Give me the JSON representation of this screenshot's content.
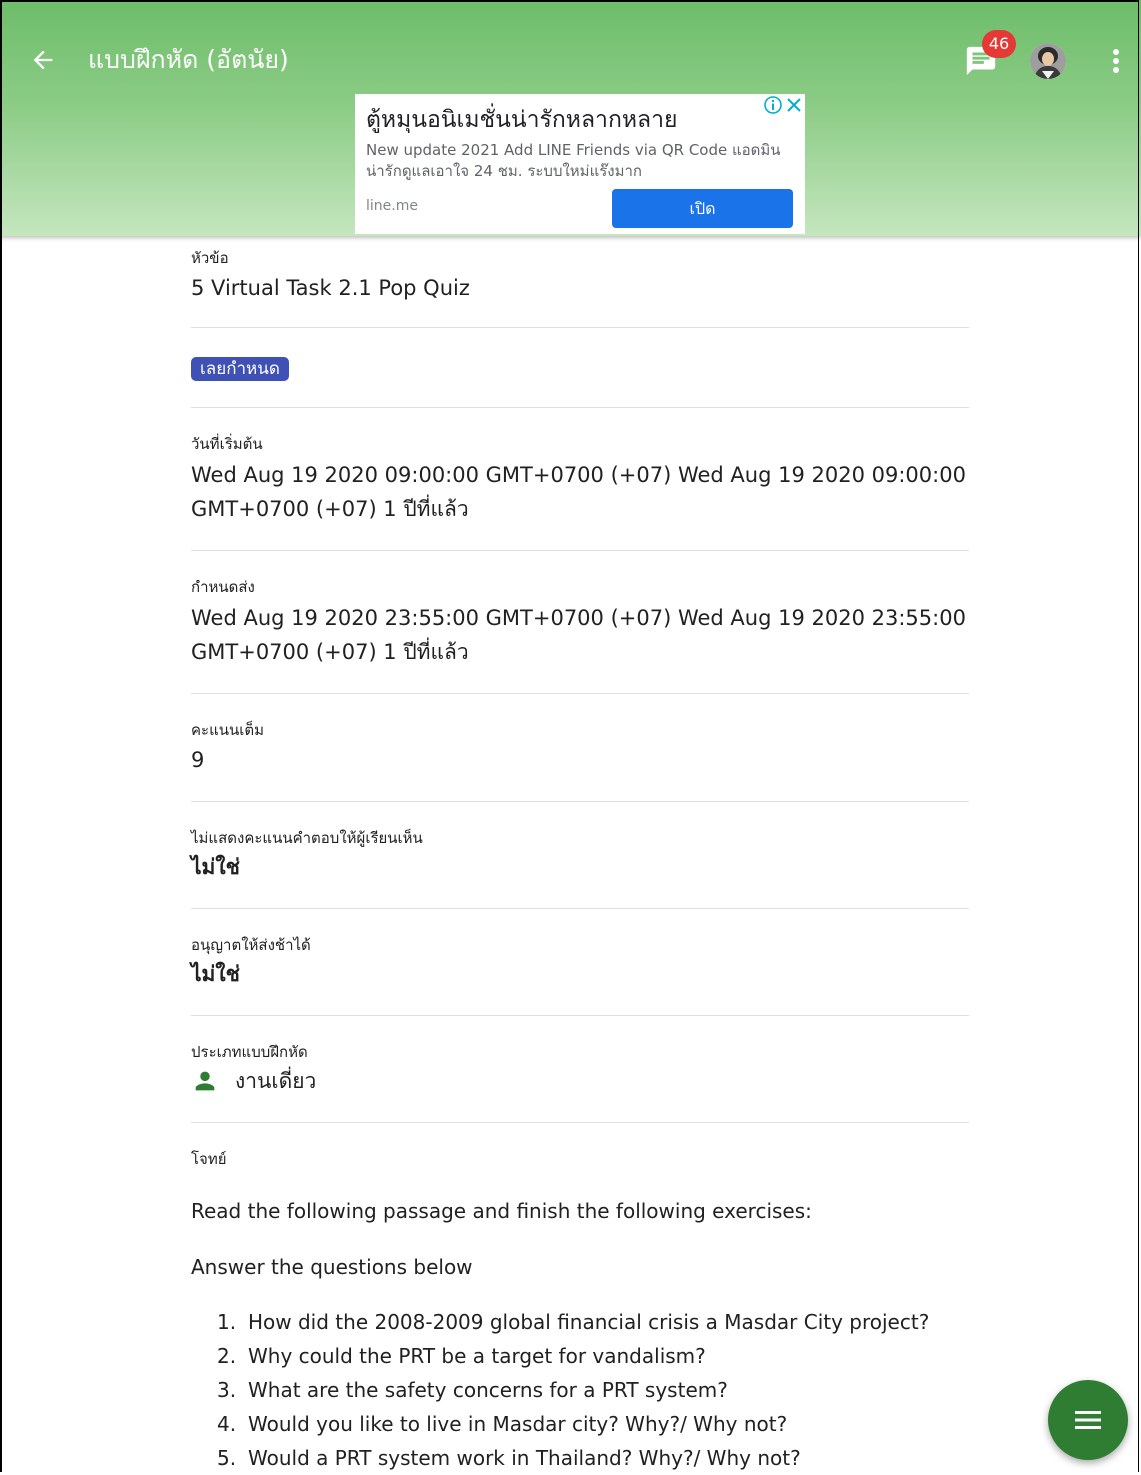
{
  "appbar": {
    "title": "แบบฝึกหัด (อัตนัย)",
    "back_icon": "arrow-left-icon",
    "chat_icon": "chat-icon",
    "chat_badge": "46",
    "more_icon": "more-vert-icon",
    "color": "#6dbd6a"
  },
  "ad": {
    "title": "ตู้หมุนอนิเมชั่นน่ารักหลากหลาย",
    "description": "New update 2021 Add LINE Friends via QR Code แอดมินน่ารักดูแลเอาใจ 24 ชม. ระบบใหม่แร๊งมาก",
    "domain": "line.me",
    "open_label": "เปิด",
    "accent": "#1a73e8"
  },
  "details": {
    "topic_label": "หัวข้อ",
    "topic_value": "5 Virtual Task 2.1 Pop Quiz",
    "status_chip": "เลยกำหนด",
    "start_label": "วันที่เริ่มต้น",
    "start_value": "Wed Aug 19 2020 09:00:00 GMT+0700 (+07) Wed Aug 19 2020 09:00:00 GMT+0700 (+07) 1 ปีที่แล้ว",
    "due_label": "กำหนดส่ง",
    "due_value": "Wed Aug 19 2020 23:55:00 GMT+0700 (+07) Wed Aug 19 2020 23:55:00 GMT+0700 (+07) 1 ปีที่แล้ว",
    "score_label": "คะแนนเต็ม",
    "score_value": "9",
    "hide_score_label": "ไม่แสดงคะแนนคำตอบให้ผู้เรียนเห็น",
    "hide_score_value": "ไม่ใช่",
    "late_label": "อนุญาตให้ส่งช้าได้",
    "late_value": "ไม่ใช่",
    "type_label": "ประเภทแบบฝึกหัด",
    "type_value": "งานเดี่ยว",
    "type_icon": "person-icon",
    "prompt_label": "โจทย์"
  },
  "prompt": {
    "intro": "Read the following passage and finish the following exercises:",
    "instruction": "Answer the questions below",
    "questions": [
      {
        "num": "1.",
        "text": "How did the 2008-2009 global financial crisis a Masdar City project?"
      },
      {
        "num": "2.",
        "text": "Why could the PRT be a target for vandalism?"
      },
      {
        "num": "3.",
        "text": "What are the safety concerns for a PRT system?"
      },
      {
        "num": "4.",
        "text": "Would you like to live in Masdar city? Why?/ Why not?"
      },
      {
        "num": "5.",
        "text": "Would a PRT system work in Thailand? Why?/ Why not?"
      }
    ]
  },
  "fab": {
    "icon": "menu-icon",
    "color": "#2e7d32"
  }
}
